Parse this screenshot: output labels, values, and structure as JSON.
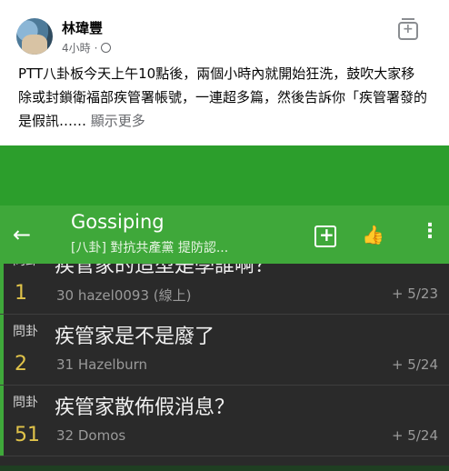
{
  "post": {
    "author": "林瑋豐",
    "time": "4小時",
    "separator": "·",
    "text": "PTT八卦板今天上午10點後，兩個小時內就開始狂洗，鼓吹大家移除或封鎖衛福部疾管署帳號，一連超多篇，然後告訴你「疾管署發的是假訊……",
    "see_more": "顯示更多"
  },
  "app": {
    "board_name": "Gossiping",
    "board_subtitle": "[八卦] 對抗共產黨 提防認...",
    "back_icon": "arrow-left-icon",
    "icons": [
      "add-post-icon",
      "thumbs-icon",
      "more-vert-icon"
    ]
  },
  "articles": [
    {
      "category": "問卦",
      "title": "疾管家的造型是學誰啊？",
      "push": "1",
      "author": "30 hazel0093 (線上)",
      "date": "+ 5/23"
    },
    {
      "category": "問卦",
      "title": "疾管家是不是廢了",
      "push": "2",
      "author": "31 Hazelburn",
      "date": "+ 5/24"
    },
    {
      "category": "問卦",
      "title": "疾管家散佈假消息？",
      "push": "51",
      "author": "32 Domos",
      "date": "+ 5/24"
    }
  ],
  "colors": {
    "ptt_green": "#3fa83a",
    "push_yellow": "#e0c34a",
    "list_bg": "#2a2a2a"
  }
}
